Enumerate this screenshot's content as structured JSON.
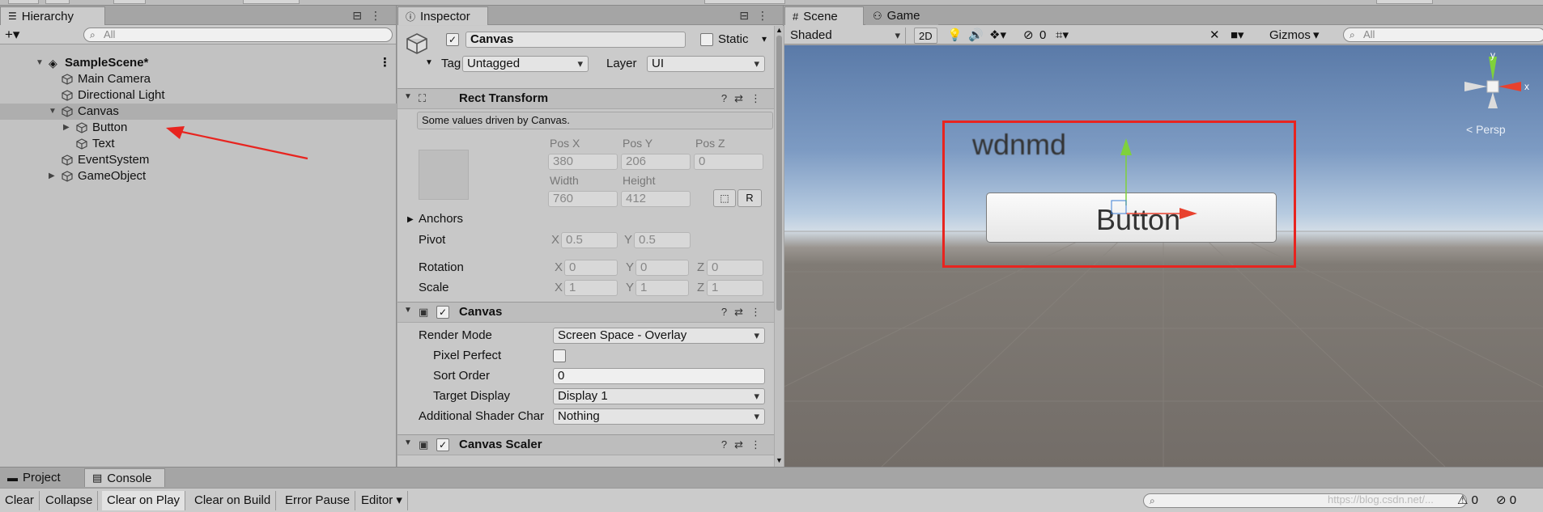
{
  "hierarchy": {
    "tab_label": "Hierarchy",
    "add_label": "+▾",
    "search_placeholder": "All",
    "items": [
      {
        "label": "SampleScene*",
        "bold": true
      },
      {
        "label": "Main Camera"
      },
      {
        "label": "Directional Light"
      },
      {
        "label": "Canvas"
      },
      {
        "label": "Button"
      },
      {
        "label": "Text"
      },
      {
        "label": "EventSystem"
      },
      {
        "label": "GameObject"
      }
    ]
  },
  "inspector": {
    "tab_label": "Inspector",
    "object_name": "Canvas",
    "static_label": "Static",
    "tag_label": "Tag",
    "tag_value": "Untagged",
    "layer_label": "Layer",
    "layer_value": "UI",
    "rect_transform": {
      "title": "Rect Transform",
      "note": "Some values driven by Canvas.",
      "posx_label": "Pos X",
      "posx": "380",
      "posy_label": "Pos Y",
      "posy": "206",
      "posz_label": "Pos Z",
      "posz": "0",
      "width_label": "Width",
      "width": "760",
      "height_label": "Height",
      "height": "412",
      "r_button": "R",
      "anchors_label": "Anchors",
      "pivot_label": "Pivot",
      "pivot_x": "0.5",
      "pivot_y": "0.5",
      "rotation_label": "Rotation",
      "rot_x": "0",
      "rot_y": "0",
      "rot_z": "0",
      "scale_label": "Scale",
      "scale_x": "1",
      "scale_y": "1",
      "scale_z": "1",
      "x": "X",
      "y": "Y",
      "z": "Z"
    },
    "canvas": {
      "title": "Canvas",
      "render_mode_label": "Render Mode",
      "render_mode": "Screen Space - Overlay",
      "pixel_perfect_label": "Pixel Perfect",
      "sort_order_label": "Sort Order",
      "sort_order": "0",
      "target_display_label": "Target Display",
      "target_display": "Display 1",
      "shader_label": "Additional Shader Char",
      "shader_value": "Nothing"
    },
    "canvas_scaler": {
      "title": "Canvas Scaler"
    }
  },
  "scene": {
    "scene_tab": "Scene",
    "game_tab": "Game",
    "shading": "Shaded",
    "mode_2d": "2D",
    "hidden_count": "0",
    "gizmos": "Gizmos",
    "search_placeholder": "All",
    "persp_label": "< Persp",
    "axis_x": "x",
    "axis_y": "y",
    "ui_text": "wdnmd",
    "ui_button": "Button"
  },
  "console": {
    "project_tab": "Project",
    "console_tab": "Console",
    "buttons": [
      "Clear",
      "Collapse",
      "Clear on Play",
      "Clear on Build",
      "Error Pause",
      "Editor ▾"
    ],
    "count_a": "0",
    "count_b": "0",
    "watermark": "https://blog.csdn.net/..."
  },
  "colors": {
    "annotation_red": "#e8241f",
    "selection": "#aeaeae",
    "gizmo_green": "#7fd13b",
    "gizmo_red": "#e8412e"
  }
}
